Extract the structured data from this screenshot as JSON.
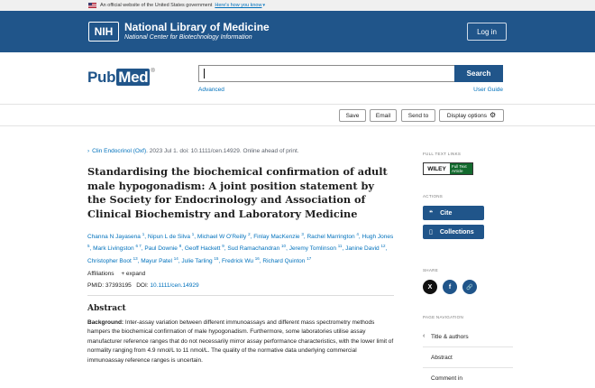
{
  "gov_banner": {
    "text": "An official website of the United States government",
    "link": "Here's how you know"
  },
  "nih_header": {
    "badge": "NIH",
    "title": "National Library of Medicine",
    "subtitle": "National Center for Biotechnology Information",
    "login_label": "Log in"
  },
  "search": {
    "logo_pub": "Pub",
    "logo_med": "Med",
    "logo_reg": "®",
    "value": "",
    "button_label": "Search",
    "advanced_label": "Advanced",
    "user_guide_label": "User Guide"
  },
  "actions": {
    "save": "Save",
    "email": "Email",
    "send_to": "Send to",
    "display_options": "Display options"
  },
  "article": {
    "journal": "Clin Endocrinol (Oxf)",
    "citation": ". 2023 Jul 1. doi: 10.1111/cen.14929. Online ahead of print.",
    "title": "Standardising the biochemical confirmation of adult male hypogonadism: A joint position statement by the Society for Endocrinology and Association of Clinical Biochemistry and Laboratory Medicine",
    "authors": [
      {
        "name": "Channa N Jayasena",
        "aff": "1"
      },
      {
        "name": "Nipun L de Silva",
        "aff": "1"
      },
      {
        "name": "Michael W O'Reilly",
        "aff": "2"
      },
      {
        "name": "Finlay MacKenzie",
        "aff": "3"
      },
      {
        "name": "Rachel Marrington",
        "aff": "4"
      },
      {
        "name": "Hugh Jones",
        "aff": "5"
      },
      {
        "name": "Mark Livingston",
        "aff": "6 7"
      },
      {
        "name": "Paul Downie",
        "aff": "8"
      },
      {
        "name": "Geoff Hackett",
        "aff": "9"
      },
      {
        "name": "Sud Ramachandran",
        "aff": "10"
      },
      {
        "name": "Jeremy Tomlinson",
        "aff": "11"
      },
      {
        "name": "Janine David",
        "aff": "12"
      },
      {
        "name": "Christopher Boot",
        "aff": "13"
      },
      {
        "name": "Mayur Patel",
        "aff": "14"
      },
      {
        "name": "Julie Tarling",
        "aff": "15"
      },
      {
        "name": "Fredrick Wu",
        "aff": "16"
      },
      {
        "name": "Richard Quinton",
        "aff": "17"
      }
    ],
    "affiliations_label": "Affiliations",
    "expand_label": "+ expand",
    "pmid_label": "PMID:",
    "pmid": "37393195",
    "doi_label": "DOI:",
    "doi": "10.1111/cen.14929",
    "abstract_heading": "Abstract",
    "abstract_bold": "Background:",
    "abstract_text": " Inter-assay variation between different immunoassays and different mass spectrometry methods hampers the biochemical confirmation of male hypogonadism. Furthermore, some laboratories utilise assay manufacturer reference ranges that do not necessarily mirror assay performance characteristics, with the lower limit of normality ranging from 4.9 nmol/L to 11 nmol/L. The quality of the normative data underlying commercial immunoassay reference ranges is uncertain."
  },
  "sidebar": {
    "full_text_label": "Full text links",
    "wiley_left": "WILEY",
    "wiley_right_1": "Full Text",
    "wiley_right_2": "Article",
    "actions_label": "Actions",
    "cite_label": "Cite",
    "collections_label": "Collections",
    "share_label": "Share",
    "twitter_glyph": "X",
    "facebook_glyph": "f",
    "link_glyph": "🔗",
    "page_nav_label": "Page navigation",
    "nav_items": [
      "Title & authors",
      "Abstract",
      "Comment in"
    ]
  },
  "colors": {
    "nih_blue": "#20558a",
    "link_blue": "#0071bc",
    "wiley_green": "#136a2e"
  }
}
